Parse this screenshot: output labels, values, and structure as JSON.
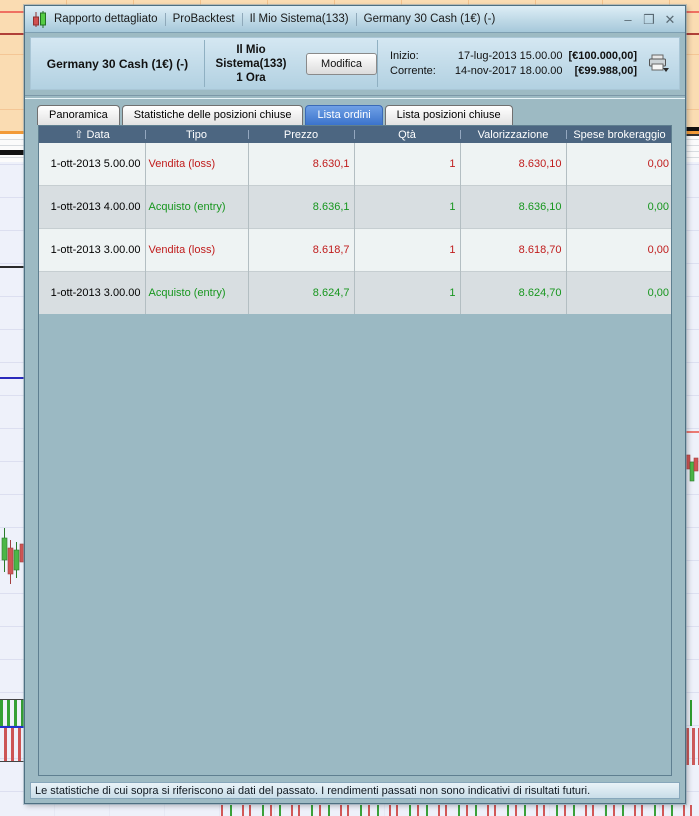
{
  "window": {
    "titlebar": {
      "segments": [
        "Rapporto dettagliato",
        "ProBacktest",
        "Il Mio Sistema(133)",
        "Germany 30 Cash (1€) (-)"
      ],
      "buttons": {
        "minimize": "–",
        "maximize": "❒",
        "close": "✕"
      }
    },
    "header": {
      "instrument": "Germany 30 Cash (1€) (-)",
      "system_name": "Il Mio Sistema(133)",
      "timeframe": "1 Ora",
      "modify_button": "Modifica",
      "start_label": "Inizio:",
      "start_datetime": "17-lug-2013 15.00.00",
      "start_value": "[€100.000,00]",
      "current_label": "Corrente:",
      "current_datetime": "14-nov-2017 18.00.00",
      "current_value": "[€99.988,00]"
    },
    "tabs": [
      {
        "label": "Panoramica",
        "active": false
      },
      {
        "label": "Statistiche delle posizioni chiuse",
        "active": false
      },
      {
        "label": "Lista ordini",
        "active": true
      },
      {
        "label": "Lista posizioni chiuse",
        "active": false
      }
    ],
    "table": {
      "sort_icon": "⇧",
      "columns": [
        "Data",
        "Tipo",
        "Prezzo",
        "Qtà",
        "Valorizzazione",
        "Spese brokeraggio"
      ],
      "rows": [
        {
          "side": "sell",
          "cells": [
            "1-ott-2013 5.00.00",
            "Vendita (loss)",
            "8.630,1",
            "1",
            "8.630,10",
            "0,00"
          ]
        },
        {
          "side": "buy",
          "cells": [
            "1-ott-2013 4.00.00",
            "Acquisto (entry)",
            "8.636,1",
            "1",
            "8.636,10",
            "0,00"
          ]
        },
        {
          "side": "sell",
          "cells": [
            "1-ott-2013 3.00.00",
            "Vendita (loss)",
            "8.618,7",
            "1",
            "8.618,70",
            "0,00"
          ]
        },
        {
          "side": "buy",
          "cells": [
            "1-ott-2013 3.00.00",
            "Acquisto (entry)",
            "8.624,7",
            "1",
            "8.624,70",
            "0,00"
          ]
        }
      ]
    },
    "disclaimer": "Le statistiche di cui sopra si riferiscono ai dati del passato. I rendimenti passati non sono indicativi di risultati futuri."
  },
  "colors": {
    "sell_text": "#c01c1c",
    "buy_text": "#17961e",
    "table_header_bg": "#4c6681",
    "active_tab": "#3b73cb",
    "window_body": "#9dbac3",
    "row_light": "#eef3f3",
    "row_dark": "#d8dee1"
  }
}
